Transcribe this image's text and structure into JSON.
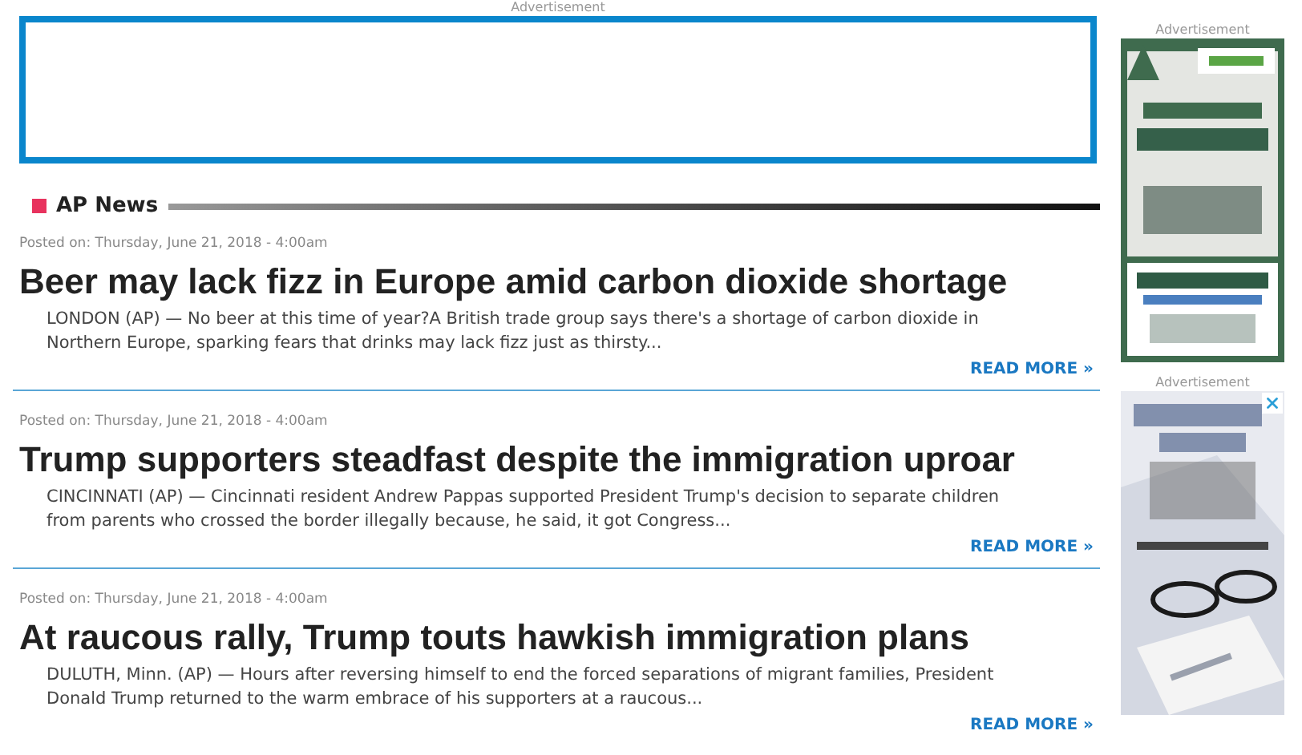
{
  "top_ad": {
    "label": "Advertisement"
  },
  "section": {
    "title": "AP News"
  },
  "articles": [
    {
      "posted": "Posted on: Thursday, June 21, 2018 - 4:00am",
      "headline": "Beer may lack fizz in Europe amid carbon dioxide shortage",
      "summary": "LONDON (AP) — No beer at this time of year?A British trade group says there's a shortage of carbon dioxide in Northern Europe, sparking fears that drinks may lack fizz just as thirsty...",
      "link": "READ MORE »"
    },
    {
      "posted": "Posted on: Thursday, June 21, 2018 - 4:00am",
      "headline": "Trump supporters steadfast despite the immigration uproar",
      "summary": "CINCINNATI (AP) — Cincinnati resident Andrew Pappas supported President Trump's decision to separate children from parents who crossed the border illegally because, he said, it got Congress...",
      "link": "READ MORE »"
    },
    {
      "posted": "Posted on: Thursday, June 21, 2018 - 4:00am",
      "headline": "At raucous rally, Trump touts hawkish immigration plans",
      "summary": "DULUTH, Minn. (AP) — Hours after reversing himself to end the forced separations of migrant families, President Donald Trump returned to the warm embrace of his supporters at a raucous...",
      "link": "READ MORE »"
    }
  ],
  "sidebar_ads": [
    {
      "label": "Advertisement",
      "kind": "picture",
      "closable": false
    },
    {
      "label": "Advertisement",
      "kind": "picture",
      "closable": true
    }
  ]
}
